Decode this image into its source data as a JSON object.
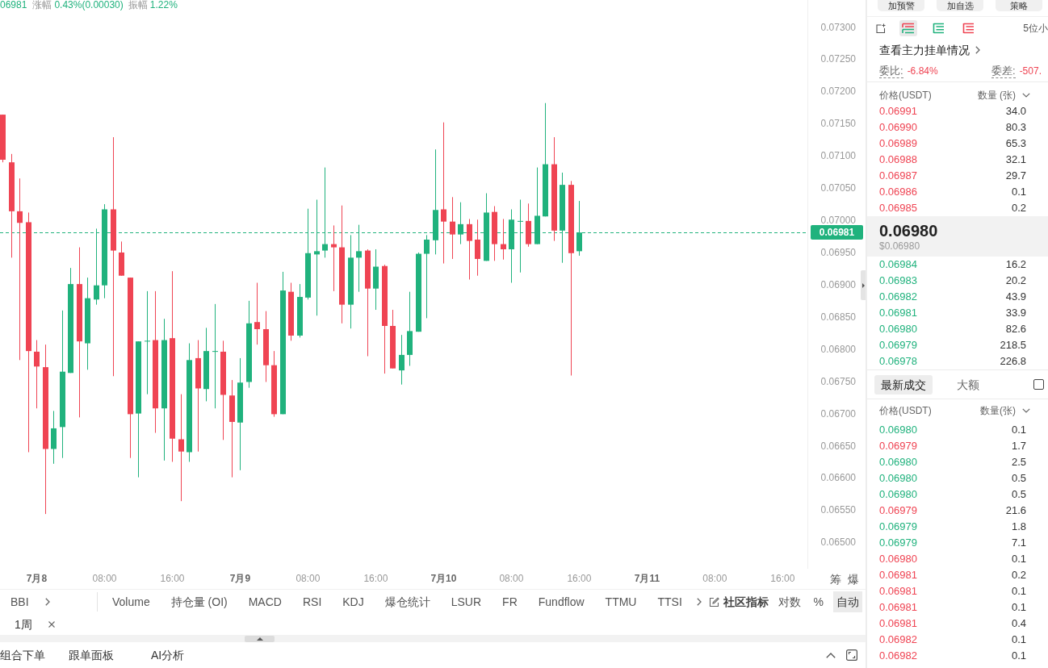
{
  "ticker_info": {
    "price": "06981",
    "change_label": "涨幅",
    "change": "0.43%(0.00030)",
    "amplitude_label": "振幅",
    "amplitude": "1.22%"
  },
  "kline_chart": {
    "chart_data": [
      {
        "type": "candlestick",
        "x": [
          "--07-07T20:00",
          "--07-07T21:00",
          "--07-07T22:00",
          "--07-07T23:00",
          "--07-08T00:00",
          "--07-08T01:00",
          "--07-08T02:00",
          "--07-08T03:00",
          "--07-08T04:00",
          "--07-08T05:00",
          "--07-08T06:00",
          "--07-08T07:00",
          "--07-08T08:00",
          "--07-08T09:00",
          "--07-08T10:00",
          "--07-08T11:00",
          "--07-08T12:00",
          "--07-08T13:00",
          "--07-08T14:00",
          "--07-08T15:00",
          "--07-08T16:00",
          "--07-08T17:00",
          "--07-08T18:00",
          "--07-08T19:00",
          "--07-08T20:00",
          "--07-08T21:00",
          "--07-08T22:00",
          "--07-08T23:00",
          "--07-09T00:00",
          "--07-09T01:00",
          "--07-09T02:00",
          "--07-09T03:00",
          "--07-09T04:00",
          "--07-09T05:00",
          "--07-09T06:00",
          "--07-09T07:00",
          "--07-09T08:00",
          "--07-09T09:00",
          "--07-09T10:00",
          "--07-09T11:00",
          "--07-09T12:00",
          "--07-09T13:00",
          "--07-09T14:00",
          "--07-09T15:00",
          "--07-09T16:00",
          "--07-09T17:00",
          "--07-09T18:00",
          "--07-09T19:00",
          "--07-09T20:00",
          "--07-09T21:00",
          "--07-09T22:00",
          "--07-09T23:00",
          "--07-10T00:00",
          "--07-10T01:00",
          "--07-10T02:00",
          "--07-10T03:00",
          "--07-10T04:00",
          "--07-10T05:00",
          "--07-10T06:00",
          "--07-10T07:00",
          "--07-10T08:00",
          "--07-10T09:00",
          "--07-10T10:00",
          "--07-10T11:00",
          "--07-10T12:00",
          "--07-10T13:00",
          "--07-10T14:00",
          "--07-10T15:00",
          "--07-10T16:00"
        ],
        "ohlc": [
          [
            0.07164,
            0.07164,
            0.0709,
            0.07094
          ],
          [
            0.0709,
            0.07103,
            0.06942,
            0.07014
          ],
          [
            0.07014,
            0.07065,
            0.06783,
            0.06996
          ],
          [
            0.06997,
            0.07012,
            0.0664,
            0.06797
          ],
          [
            0.06796,
            0.06814,
            0.06708,
            0.06773
          ],
          [
            0.06772,
            0.06807,
            0.06544,
            0.06645
          ],
          [
            0.06645,
            0.06704,
            0.06622,
            0.06677
          ],
          [
            0.06679,
            0.0686,
            0.06631,
            0.06765
          ],
          [
            0.06763,
            0.06926,
            0.06763,
            0.06901
          ],
          [
            0.06901,
            0.06958,
            0.06694,
            0.06812
          ],
          [
            0.06809,
            0.06911,
            0.06768,
            0.06879
          ],
          [
            0.06877,
            0.06987,
            0.06869,
            0.06899
          ],
          [
            0.06899,
            0.07025,
            0.06879,
            0.07017
          ],
          [
            0.07017,
            0.07129,
            0.06758,
            0.06953
          ],
          [
            0.0695,
            0.06967,
            0.06914,
            0.06914
          ],
          [
            0.06911,
            0.06911,
            0.06631,
            0.06699
          ],
          [
            0.067,
            0.06812,
            0.06601,
            0.06812
          ],
          [
            0.06812,
            0.0689,
            0.0673,
            0.06813
          ],
          [
            0.06814,
            0.0689,
            0.0667,
            0.06708
          ],
          [
            0.06708,
            0.06847,
            0.06627,
            0.06814
          ],
          [
            0.06817,
            0.06921,
            0.06625,
            0.06661
          ],
          [
            0.0666,
            0.0673,
            0.06564,
            0.06641
          ],
          [
            0.0664,
            0.06809,
            0.06625,
            0.06783
          ],
          [
            0.06786,
            0.06814,
            0.06641,
            0.06739
          ],
          [
            0.06738,
            0.06833,
            0.06719,
            0.06797
          ],
          [
            0.06796,
            0.0687,
            0.06708,
            0.06797
          ],
          [
            0.06796,
            0.06813,
            0.06659,
            0.06729
          ],
          [
            0.06728,
            0.06752,
            0.06601,
            0.06687
          ],
          [
            0.06686,
            0.06786,
            0.06612,
            0.06748
          ],
          [
            0.06749,
            0.06875,
            0.0674,
            0.0684
          ],
          [
            0.06842,
            0.06903,
            0.06807,
            0.06831
          ],
          [
            0.06831,
            0.06859,
            0.06749,
            0.06775
          ],
          [
            0.06775,
            0.06797,
            0.06695,
            0.06699
          ],
          [
            0.06699,
            0.0692,
            0.06699,
            0.06891
          ],
          [
            0.06889,
            0.06903,
            0.06813,
            0.06821
          ],
          [
            0.06821,
            0.06901,
            0.06818,
            0.06881
          ],
          [
            0.0688,
            0.07018,
            0.06877,
            0.06949
          ],
          [
            0.06947,
            0.07032,
            0.06852,
            0.06952
          ],
          [
            0.06953,
            0.07082,
            0.06942,
            0.06963
          ],
          [
            0.06963,
            0.06992,
            0.0689,
            0.06958
          ],
          [
            0.06958,
            0.07023,
            0.0684,
            0.06869
          ],
          [
            0.06869,
            0.06977,
            0.06832,
            0.06942
          ],
          [
            0.06942,
            0.06993,
            0.06889,
            0.06952
          ],
          [
            0.06953,
            0.06955,
            0.06789,
            0.06894
          ],
          [
            0.06894,
            0.06955,
            0.06861,
            0.06928
          ],
          [
            0.06929,
            0.06931,
            0.06762,
            0.06836
          ],
          [
            0.06836,
            0.06861,
            0.0677,
            0.0677
          ],
          [
            0.06767,
            0.06822,
            0.06745,
            0.06791
          ],
          [
            0.06791,
            0.06889,
            0.06774,
            0.06828
          ],
          [
            0.06827,
            0.0695,
            0.06827,
            0.06948
          ],
          [
            0.06948,
            0.06977,
            0.06848,
            0.0697
          ],
          [
            0.06969,
            0.0711,
            0.06947,
            0.07016
          ],
          [
            0.07017,
            0.07152,
            0.06933,
            0.06998
          ],
          [
            0.06998,
            0.07036,
            0.0694,
            0.06978
          ],
          [
            0.06978,
            0.07028,
            0.06963,
            0.06994
          ],
          [
            0.06994,
            0.07002,
            0.06908,
            0.06968
          ],
          [
            0.0697,
            0.07001,
            0.06914,
            0.0694
          ],
          [
            0.06937,
            0.07042,
            0.06937,
            0.07012
          ],
          [
            0.07013,
            0.07022,
            0.06937,
            0.06963
          ],
          [
            0.06963,
            0.07002,
            0.06939,
            0.06955
          ],
          [
            0.06955,
            0.07017,
            0.06903,
            0.07001
          ],
          [
            0.06999,
            0.07032,
            0.06919,
            0.06999
          ],
          [
            0.06999,
            0.07026,
            0.06959,
            0.06963
          ],
          [
            0.06963,
            0.07082,
            0.06963,
            0.07007
          ],
          [
            0.07006,
            0.07182,
            0.07006,
            0.07087
          ],
          [
            0.07087,
            0.07129,
            0.06968,
            0.06984
          ],
          [
            0.06984,
            0.07074,
            0.06934,
            0.07055
          ],
          [
            0.07055,
            0.07061,
            0.06759,
            0.06949
          ],
          [
            0.06952,
            0.0703,
            0.06945,
            0.06981
          ]
        ],
        "xlim": [
          "--07-07T19:40",
          "--07-11T18:55"
        ],
        "ylim": [
          0.06459,
          0.07342
        ],
        "xticks": [
          {
            "value": "--07-08T00:00",
            "label": "7月8"
          },
          {
            "value": "--07-08T08:00",
            "label": "08:00"
          },
          {
            "value": "--07-08T16:00",
            "label": "16:00"
          },
          {
            "value": "--07-09T00:00",
            "label": "7月9"
          },
          {
            "value": "--07-09T08:00",
            "label": "08:00"
          },
          {
            "value": "--07-09T16:00",
            "label": "16:00"
          },
          {
            "value": "--07-10T00:00",
            "label": "7月10"
          },
          {
            "value": "--07-10T08:00",
            "label": "08:00"
          },
          {
            "value": "--07-10T16:00",
            "label": "16:00"
          },
          {
            "value": "--07-11T00:00",
            "label": "7月11"
          },
          {
            "value": "--07-11T08:00",
            "label": "08:00"
          },
          {
            "value": "--07-11T16:00",
            "label": "16:00"
          }
        ],
        "yticks": [
          {
            "value": 0.073,
            "label": "0.07300"
          },
          {
            "value": 0.0725,
            "label": "0.07250"
          },
          {
            "value": 0.072,
            "label": "0.07200"
          },
          {
            "value": 0.0715,
            "label": "0.07150"
          },
          {
            "value": 0.071,
            "label": "0.07100"
          },
          {
            "value": 0.0705,
            "label": "0.07050"
          },
          {
            "value": 0.07,
            "label": "0.07000"
          },
          {
            "value": 0.0695,
            "label": "0.06950"
          },
          {
            "value": 0.069,
            "label": "0.06900"
          },
          {
            "value": 0.0685,
            "label": "0.06850"
          },
          {
            "value": 0.068,
            "label": "0.06800"
          },
          {
            "value": 0.0675,
            "label": "0.06750"
          },
          {
            "value": 0.067,
            "label": "0.06700"
          },
          {
            "value": 0.0665,
            "label": "0.06650"
          },
          {
            "value": 0.066,
            "label": "0.06600"
          },
          {
            "value": 0.0655,
            "label": "0.06550"
          },
          {
            "value": 0.065,
            "label": "0.06500"
          }
        ],
        "ref_lines": [
          {
            "axis": "y",
            "value": 0.06981,
            "label": "0.06981",
            "color": "#20b27d",
            "line_style": "dashed"
          }
        ]
      }
    ],
    "tools": [
      "筹",
      "爆"
    ]
  },
  "indicator_bar": {
    "main": [
      "BBI"
    ],
    "sub": [
      "Volume",
      "持仓量 (OI)",
      "MACD",
      "RSI",
      "KDJ",
      "爆仓统计",
      "LSUR",
      "FR",
      "Fundflow",
      "TTMU",
      "TTSI"
    ],
    "community": "社区指标",
    "scale_options": [
      {
        "label": "对数",
        "selected": false
      },
      {
        "label": "%",
        "selected": false
      },
      {
        "label": "自动",
        "selected": true
      }
    ]
  },
  "interval_tags": [
    "1周"
  ],
  "bottom_tabs": [
    "组合下单",
    "跟单面板",
    "AI分析"
  ],
  "side_panel": {
    "actions": [
      "加预警",
      "加自选",
      "策略"
    ],
    "book_views": [
      {
        "kind": "split",
        "selected": true
      },
      {
        "kind": "bids",
        "selected": false
      },
      {
        "kind": "asks",
        "selected": false
      }
    ],
    "precision": "5位小",
    "main_orders_link": "查看主力挂单情况",
    "ratio_label": "委比:",
    "ratio": "-6.84%",
    "diff_label": "委差:",
    "diff": "-507.",
    "book_header": {
      "price": "价格(USDT)",
      "amount": "数量 (张)"
    },
    "asks": [
      {
        "price": "0.06991",
        "amount": "34.0"
      },
      {
        "price": "0.06990",
        "amount": "80.3"
      },
      {
        "price": "0.06989",
        "amount": "65.3"
      },
      {
        "price": "0.06988",
        "amount": "32.1"
      },
      {
        "price": "0.06987",
        "amount": "29.7"
      },
      {
        "price": "0.06986",
        "amount": "0.1"
      },
      {
        "price": "0.06985",
        "amount": "0.2"
      }
    ],
    "last_price": "0.06980",
    "last_price_usd": "$0.06980",
    "bids": [
      {
        "price": "0.06984",
        "amount": "16.2"
      },
      {
        "price": "0.06983",
        "amount": "20.2"
      },
      {
        "price": "0.06982",
        "amount": "43.9"
      },
      {
        "price": "0.06981",
        "amount": "33.9"
      },
      {
        "price": "0.06980",
        "amount": "82.6"
      },
      {
        "price": "0.06979",
        "amount": "218.5"
      },
      {
        "price": "0.06978",
        "amount": "226.8"
      }
    ],
    "trade_tabs": [
      {
        "label": "最新成交",
        "selected": true
      },
      {
        "label": "大额",
        "selected": false
      }
    ],
    "large_only": {
      "checked": false
    },
    "trades_header": {
      "price": "价格(USDT)",
      "amount": "数量(张)"
    },
    "trades": [
      {
        "price": "0.06980",
        "amount": "0.1",
        "color": "#20b27d"
      },
      {
        "price": "0.06979",
        "amount": "1.7",
        "color": "#ef4453"
      },
      {
        "price": "0.06980",
        "amount": "2.5",
        "color": "#20b27d"
      },
      {
        "price": "0.06980",
        "amount": "0.5",
        "color": "#20b27d"
      },
      {
        "price": "0.06980",
        "amount": "0.5",
        "color": "#20b27d"
      },
      {
        "price": "0.06979",
        "amount": "21.6",
        "color": "#ef4453"
      },
      {
        "price": "0.06979",
        "amount": "1.8",
        "color": "#20b27d"
      },
      {
        "price": "0.06979",
        "amount": "7.1",
        "color": "#20b27d"
      },
      {
        "price": "0.06980",
        "amount": "0.1",
        "color": "#ef4453"
      },
      {
        "price": "0.06981",
        "amount": "0.2",
        "color": "#ef4453"
      },
      {
        "price": "0.06981",
        "amount": "0.1",
        "color": "#ef4453"
      },
      {
        "price": "0.06981",
        "amount": "0.1",
        "color": "#ef4453"
      },
      {
        "price": "0.06981",
        "amount": "0.4",
        "color": "#ef4453"
      },
      {
        "price": "0.06982",
        "amount": "0.1",
        "color": "#ef4453"
      },
      {
        "price": "0.06982",
        "amount": "0.1",
        "color": "#ef4453"
      }
    ]
  }
}
